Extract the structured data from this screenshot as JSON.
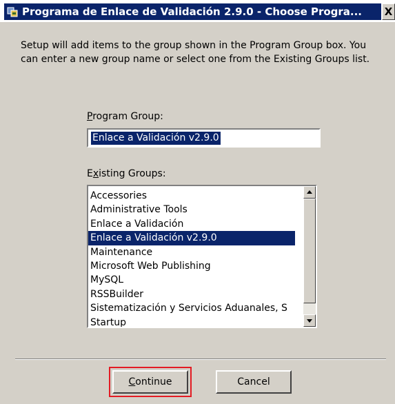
{
  "window": {
    "title": "Programa de Enlace de Validación 2.9.0 - Choose Progra...",
    "close_glyph": "X"
  },
  "description": "Setup will add items to the group shown in the Program Group box. You can enter a new group name or select one from the Existing Groups list.",
  "program_group": {
    "label_u": "P",
    "label_rest": "rogram Group:",
    "value": "Enlace a Validación v2.9.0"
  },
  "existing_groups": {
    "label_pre": "E",
    "label_u": "x",
    "label_rest": "isting Groups:",
    "items": [
      "Accessories",
      "Administrative Tools",
      "Enlace a Validación",
      "Enlace a Validación v2.9.0",
      "Maintenance",
      "Microsoft Web Publishing",
      "MySQL",
      "RSSBuilder",
      "Sistematización y Servicios Aduanales, S",
      "Startup"
    ],
    "selected_item": "Enlace a Validación v2.9.0"
  },
  "buttons": {
    "continue_u": "C",
    "continue_rest": "ontinue",
    "cancel": "Cancel"
  },
  "colors": {
    "selection": "#0a246a",
    "highlight_outline": "#e31b23",
    "dialog_bg": "#d4d0c8"
  }
}
